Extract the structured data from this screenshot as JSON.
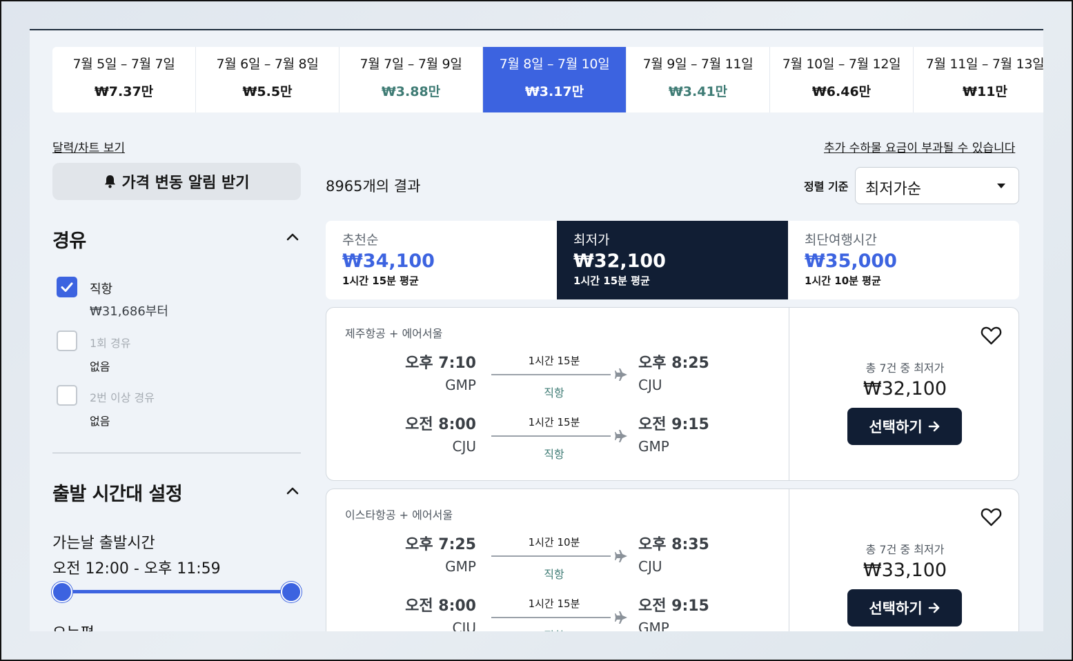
{
  "date_strip": [
    {
      "range": "7월 5일 – 7월 7일",
      "price": "₩7.37만",
      "state": "normal"
    },
    {
      "range": "7월 6일 – 7월 8일",
      "price": "₩5.5만",
      "state": "normal"
    },
    {
      "range": "7월 7일 – 7월 9일",
      "price": "₩3.88만",
      "state": "green"
    },
    {
      "range": "7월 8일 – 7월 10일",
      "price": "₩3.17만",
      "state": "selected"
    },
    {
      "range": "7월 9일 – 7월 11일",
      "price": "₩3.41만",
      "state": "green"
    },
    {
      "range": "7월 10일 – 7월 12일",
      "price": "₩6.46만",
      "state": "normal"
    },
    {
      "range": "7월 11일 – 7월 13일",
      "price": "₩11만",
      "state": "normal"
    }
  ],
  "links": {
    "calendar_chart": "달력/차트 보기",
    "baggage_fee": "추가 수하물 요금이 부과될 수 있습니다"
  },
  "price_alert": {
    "label": "가격 변동 알림 받기",
    "icon": "bell-icon"
  },
  "stops_filter": {
    "title": "경유",
    "options": [
      {
        "label": "직항",
        "sub": "₩31,686부터",
        "checked": true
      },
      {
        "label": "1회 경유",
        "sub": "없음",
        "checked": false
      },
      {
        "label": "2번 이상 경유",
        "sub": "없음",
        "checked": false
      }
    ]
  },
  "departure_time": {
    "title": "출발 시간대 설정",
    "outbound_label": "가는날 출발시간",
    "outbound_range": "오전 12:00 - 오후 11:59",
    "slider_min_fraction": 0,
    "slider_max_fraction": 1,
    "return_label": "오는편"
  },
  "results": {
    "count_text": "8965개의 결과",
    "sort_label": "정렬 기준",
    "sort_value": "최저가순"
  },
  "sort_tabs": [
    {
      "label": "추천순",
      "price": "₩34,100",
      "sub": "1시간 15분 평균",
      "active": false
    },
    {
      "label": "최저가",
      "price": "₩32,100",
      "sub": "1시간 15분 평균",
      "active": true
    },
    {
      "label": "최단여행시간",
      "price": "₩35,000",
      "sub": "1시간 10분 평균",
      "active": false
    }
  ],
  "flights": [
    {
      "airline": "제주항공 + 에어서울",
      "legs": [
        {
          "dep_time": "오후 7:10",
          "dep_code": "GMP",
          "duration": "1시간 15분",
          "stops": "직항",
          "arr_time": "오후 8:25",
          "arr_code": "CJU"
        },
        {
          "dep_time": "오전 8:00",
          "dep_code": "CJU",
          "duration": "1시간 15분",
          "stops": "직항",
          "arr_time": "오전 9:15",
          "arr_code": "GMP"
        }
      ],
      "deal_text": "총 7건 중 최저가",
      "price": "₩32,100",
      "select_label": "선택하기"
    },
    {
      "airline": "이스타항공 + 에어서울",
      "legs": [
        {
          "dep_time": "오후 7:25",
          "dep_code": "GMP",
          "duration": "1시간 10분",
          "stops": "직항",
          "arr_time": "오후 8:35",
          "arr_code": "CJU"
        },
        {
          "dep_time": "오전 8:00",
          "dep_code": "CJU",
          "duration": "1시간 15분",
          "stops": "직항",
          "arr_time": "오전 9:15",
          "arr_code": "GMP"
        }
      ],
      "deal_text": "총 7건 중 최저가",
      "price": "₩33,100",
      "select_label": "선택하기"
    }
  ],
  "colors": {
    "accent": "#3c63e0",
    "dark": "#111e34",
    "green": "#3e7b74"
  }
}
